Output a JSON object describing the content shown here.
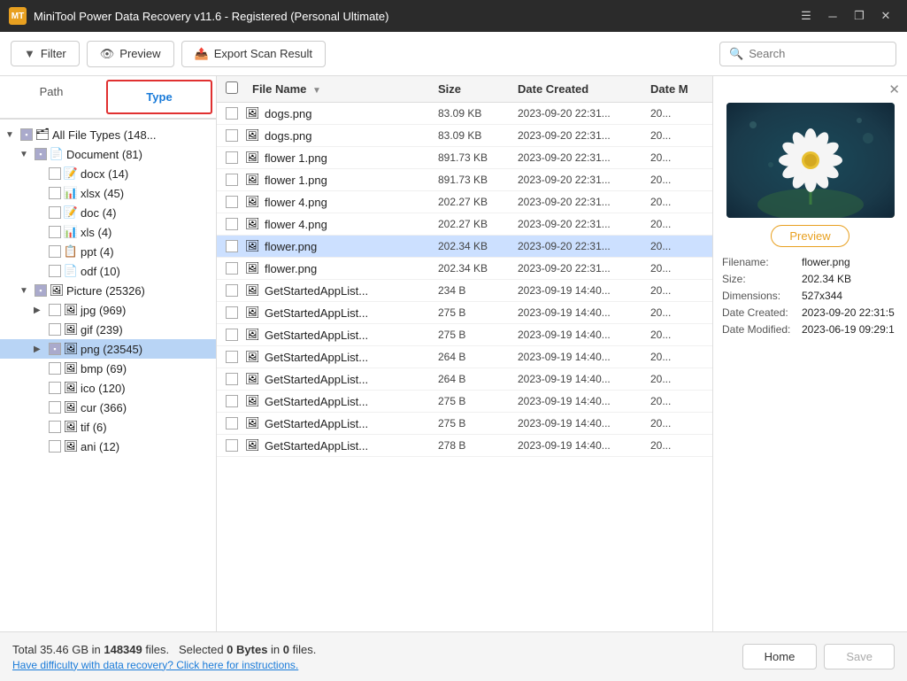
{
  "titlebar": {
    "title": "MiniTool Power Data Recovery v11.6 - Registered (Personal Ultimate)",
    "icon_label": "MT"
  },
  "toolbar": {
    "filter_label": "Filter",
    "preview_label": "Preview",
    "export_label": "Export Scan Result",
    "search_placeholder": "Search"
  },
  "tabs": {
    "path_label": "Path",
    "type_label": "Type"
  },
  "tree": {
    "items": [
      {
        "id": "all",
        "level": 0,
        "expand": "▼",
        "checked": "partial",
        "icon": "🗂",
        "label": "All File Types (148..."
      },
      {
        "id": "doc",
        "level": 1,
        "expand": "▼",
        "checked": "partial",
        "icon": "📄",
        "label": "Document (81)"
      },
      {
        "id": "docx",
        "level": 2,
        "expand": "",
        "checked": "unchecked",
        "icon": "📝",
        "label": "docx (14)"
      },
      {
        "id": "xlsx",
        "level": 2,
        "expand": "",
        "checked": "unchecked",
        "icon": "📊",
        "label": "xlsx (45)"
      },
      {
        "id": "doc2",
        "level": 2,
        "expand": "",
        "checked": "unchecked",
        "icon": "📝",
        "label": "doc (4)"
      },
      {
        "id": "xls",
        "level": 2,
        "expand": "",
        "checked": "unchecked",
        "icon": "📊",
        "label": "xls (4)"
      },
      {
        "id": "ppt",
        "level": 2,
        "expand": "",
        "checked": "unchecked",
        "icon": "📋",
        "label": "ppt (4)"
      },
      {
        "id": "odf",
        "level": 2,
        "expand": "",
        "checked": "unchecked",
        "icon": "📄",
        "label": "odf (10)"
      },
      {
        "id": "picture",
        "level": 1,
        "expand": "▼",
        "checked": "partial",
        "icon": "🖼",
        "label": "Picture (25326)"
      },
      {
        "id": "jpg",
        "level": 2,
        "expand": "▶",
        "checked": "unchecked",
        "icon": "🖼",
        "label": "jpg (969)"
      },
      {
        "id": "gif",
        "level": 2,
        "expand": "",
        "checked": "unchecked",
        "icon": "🖼",
        "label": "gif (239)"
      },
      {
        "id": "png",
        "level": 2,
        "expand": "▶",
        "checked": "partial",
        "icon": "🖼",
        "label": "png (23545)",
        "highlighted": true
      },
      {
        "id": "bmp",
        "level": 2,
        "expand": "",
        "checked": "unchecked",
        "icon": "🖼",
        "label": "bmp (69)"
      },
      {
        "id": "ico",
        "level": 2,
        "expand": "",
        "checked": "unchecked",
        "icon": "🖼",
        "label": "ico (120)"
      },
      {
        "id": "cur",
        "level": 2,
        "expand": "",
        "checked": "unchecked",
        "icon": "🖼",
        "label": "cur (366)"
      },
      {
        "id": "tif",
        "level": 2,
        "expand": "",
        "checked": "unchecked",
        "icon": "🖼",
        "label": "tif (6)"
      },
      {
        "id": "ani",
        "level": 2,
        "expand": "",
        "checked": "unchecked",
        "icon": "🖼",
        "label": "ani (12)"
      }
    ]
  },
  "file_list": {
    "columns": {
      "name": "File Name",
      "size": "Size",
      "date_created": "Date Created",
      "date_modified": "Date M"
    },
    "rows": [
      {
        "id": 1,
        "name": "dogs.png",
        "size": "83.09 KB",
        "date_created": "2023-09-20 22:31...",
        "date_modified": "20..."
      },
      {
        "id": 2,
        "name": "dogs.png",
        "size": "83.09 KB",
        "date_created": "2023-09-20 22:31...",
        "date_modified": "20..."
      },
      {
        "id": 3,
        "name": "flower 1.png",
        "size": "891.73 KB",
        "date_created": "2023-09-20 22:31...",
        "date_modified": "20..."
      },
      {
        "id": 4,
        "name": "flower 1.png",
        "size": "891.73 KB",
        "date_created": "2023-09-20 22:31...",
        "date_modified": "20..."
      },
      {
        "id": 5,
        "name": "flower 4.png",
        "size": "202.27 KB",
        "date_created": "2023-09-20 22:31...",
        "date_modified": "20..."
      },
      {
        "id": 6,
        "name": "flower 4.png",
        "size": "202.27 KB",
        "date_created": "2023-09-20 22:31...",
        "date_modified": "20..."
      },
      {
        "id": 7,
        "name": "flower.png",
        "size": "202.34 KB",
        "date_created": "2023-09-20 22:31...",
        "date_modified": "20...",
        "selected": true
      },
      {
        "id": 8,
        "name": "flower.png",
        "size": "202.34 KB",
        "date_created": "2023-09-20 22:31...",
        "date_modified": "20..."
      },
      {
        "id": 9,
        "name": "GetStartedAppList...",
        "size": "234 B",
        "date_created": "2023-09-19 14:40...",
        "date_modified": "20..."
      },
      {
        "id": 10,
        "name": "GetStartedAppList...",
        "size": "275 B",
        "date_created": "2023-09-19 14:40...",
        "date_modified": "20..."
      },
      {
        "id": 11,
        "name": "GetStartedAppList...",
        "size": "275 B",
        "date_created": "2023-09-19 14:40...",
        "date_modified": "20..."
      },
      {
        "id": 12,
        "name": "GetStartedAppList...",
        "size": "264 B",
        "date_created": "2023-09-19 14:40...",
        "date_modified": "20..."
      },
      {
        "id": 13,
        "name": "GetStartedAppList...",
        "size": "264 B",
        "date_created": "2023-09-19 14:40...",
        "date_modified": "20..."
      },
      {
        "id": 14,
        "name": "GetStartedAppList...",
        "size": "275 B",
        "date_created": "2023-09-19 14:40...",
        "date_modified": "20..."
      },
      {
        "id": 15,
        "name": "GetStartedAppList...",
        "size": "275 B",
        "date_created": "2023-09-19 14:40...",
        "date_modified": "20..."
      },
      {
        "id": 16,
        "name": "GetStartedAppList...",
        "size": "278 B",
        "date_created": "2023-09-19 14:40...",
        "date_modified": "20..."
      }
    ]
  },
  "preview": {
    "close_icon": "✕",
    "preview_btn_label": "Preview",
    "filename_label": "Filename:",
    "filename_val": "flower.png",
    "size_label": "Size:",
    "size_val": "202.34 KB",
    "dimensions_label": "Dimensions:",
    "dimensions_val": "527x344",
    "date_created_label": "Date Created:",
    "date_created_val": "2023-09-20 22:31:5",
    "date_modified_label": "Date Modified:",
    "date_modified_val": "2023-06-19 09:29:1"
  },
  "statusbar": {
    "total_text": "Total 35.46 GB in",
    "total_files": "148349",
    "files_label": "files.",
    "selected_label": "Selected",
    "selected_bytes": "0 Bytes",
    "in_label": "in",
    "selected_files": "0",
    "files_label2": "files.",
    "help_link": "Have difficulty with data recovery? Click here for instructions.",
    "home_btn": "Home",
    "save_btn": "Save"
  },
  "colors": {
    "accent": "#1a7bd9",
    "title_bg": "#2b2b2b",
    "selected_row": "#cce0ff",
    "preview_btn_color": "#e8a020"
  }
}
